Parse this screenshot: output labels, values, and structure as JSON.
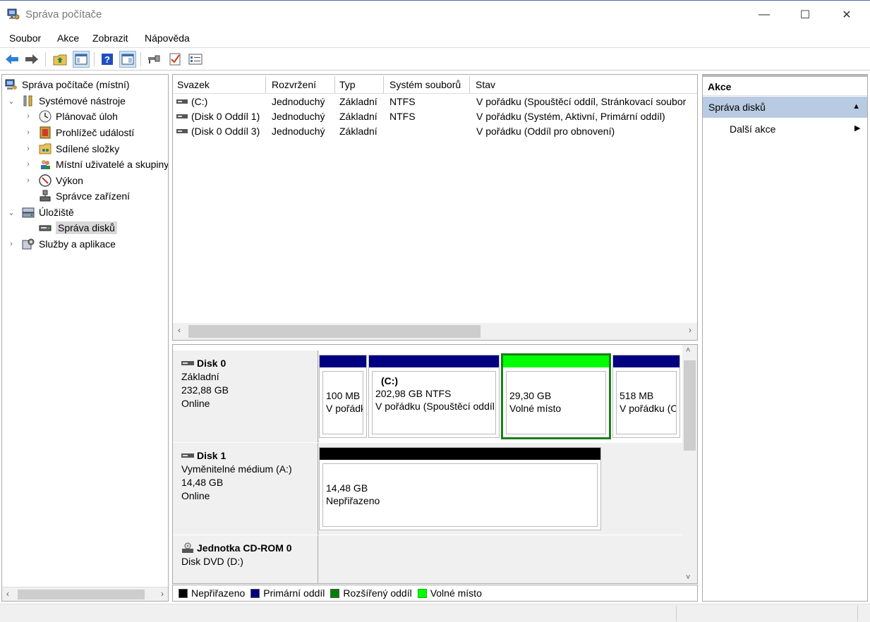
{
  "window": {
    "title": "Správa počítače",
    "minimize_glyph": "—",
    "maximize_glyph": "☐",
    "close_glyph": "✕"
  },
  "menu": [
    "Soubor",
    "Akce",
    "Zobrazit",
    "Nápověda"
  ],
  "toolbar": {
    "buttons": [
      "back-arrow-icon",
      "forward-arrow-icon",
      "up-folder-icon",
      "show-hide-tree-icon",
      "help-icon",
      "properties-icon",
      "connect-icon",
      "check-icon",
      "settings-list-icon"
    ]
  },
  "tree": {
    "items": [
      {
        "label": "Správa počítače (místní)",
        "level": 0,
        "expander": ""
      },
      {
        "label": "Systémové nástroje",
        "level": 1,
        "expander": "⌄"
      },
      {
        "label": "Plánovač úloh",
        "level": 2,
        "expander": "›"
      },
      {
        "label": "Prohlížeč událostí",
        "level": 2,
        "expander": "›"
      },
      {
        "label": "Sdílené složky",
        "level": 2,
        "expander": "›"
      },
      {
        "label": "Místní uživatelé a skupiny",
        "level": 2,
        "expander": "›"
      },
      {
        "label": "Výkon",
        "level": 2,
        "expander": "›"
      },
      {
        "label": "Správce zařízení",
        "level": 2,
        "expander": ""
      },
      {
        "label": "Úložiště",
        "level": 1,
        "expander": "⌄"
      },
      {
        "label": "Správa disků",
        "level": 2,
        "expander": "",
        "selected": true
      },
      {
        "label": "Služby a aplikace",
        "level": 1,
        "expander": "›"
      }
    ]
  },
  "volumes": {
    "columns": [
      "Svazek",
      "Rozvržení",
      "Typ",
      "Systém souborů",
      "Stav"
    ],
    "rows": [
      {
        "svazek": "(C:)",
        "rozvrzeni": "Jednoduchý",
        "typ": "Základní",
        "fs": "NTFS",
        "stav": "V pořádku (Spouštěcí oddíl, Stránkovací soubor"
      },
      {
        "svazek": "(Disk 0 Oddíl 1)",
        "rozvrzeni": "Jednoduchý",
        "typ": "Základní",
        "fs": "NTFS",
        "stav": "V pořádku (Systém, Aktivní, Primární oddíl)"
      },
      {
        "svazek": "(Disk 0 Oddíl 3)",
        "rozvrzeni": "Jednoduchý",
        "typ": "Základní",
        "fs": "",
        "stav": "V pořádku (Oddíl pro obnovení)"
      }
    ]
  },
  "disks": [
    {
      "name": "Disk 0",
      "lines": [
        "Základní",
        "232,88 GB",
        "Online"
      ],
      "partitions": [
        {
          "title": "",
          "size": "100 MB",
          "status": "V pořádku (Systém, Aktivní, Primární oddíl)",
          "bar_color": "#000080"
        },
        {
          "title": "(C:)",
          "size": "202,98 GB NTFS",
          "status": "V pořádku (Spouštěcí oddíl, Stránkovací soubor)",
          "bar_color": "#000080"
        },
        {
          "title": "",
          "size": "29,30 GB",
          "status": "Volné místo",
          "bar_color": "#00ff00",
          "selected": true
        },
        {
          "title": "",
          "size": "518 MB",
          "status": "V pořádku (Oddíl pro obnovení)",
          "bar_color": "#000080"
        }
      ]
    },
    {
      "name": "Disk 1",
      "lines": [
        "Vyměnitelné médium (A:)",
        "14,48 GB",
        "Online"
      ],
      "partitions": [
        {
          "title": "",
          "size": "14,48 GB",
          "status": "Nepřiřazeno",
          "bar_color": "#000000"
        }
      ]
    },
    {
      "name": "Jednotka CD-ROM 0",
      "lines": [
        "Disk DVD (D:)"
      ],
      "partitions": []
    }
  ],
  "legend": [
    {
      "label": "Nepřiřazeno",
      "color": "#000000"
    },
    {
      "label": "Primární oddíl",
      "color": "#000080"
    },
    {
      "label": "Rozšířený oddíl",
      "color": "#008000"
    },
    {
      "label": "Volné místo",
      "color": "#00ff00"
    }
  ],
  "actions": {
    "title": "Akce",
    "section": "Správa disků",
    "more": "Další akce"
  },
  "scroll_glyphs": {
    "left": "‹",
    "right": "›",
    "up": "˄",
    "down": "˅"
  }
}
